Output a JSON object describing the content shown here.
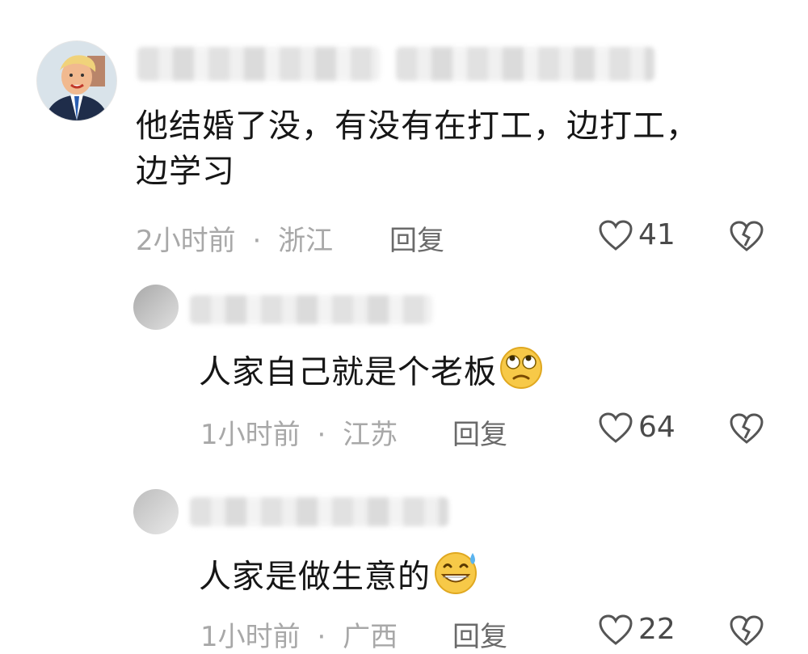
{
  "comments": [
    {
      "text": "他结婚了没，有没有在打工，边打工，边学习",
      "time": "2小时前",
      "location": "浙江",
      "reply_label": "回复",
      "likes": "41"
    },
    {
      "text": "人家自己就是个老板",
      "time": "1小时前",
      "location": "江苏",
      "reply_label": "回复",
      "likes": "64",
      "emoji": "rolling-eyes-emoji"
    },
    {
      "text": "人家是做生意的",
      "time": "1小时前",
      "location": "广西",
      "reply_label": "回复",
      "likes": "22",
      "emoji": "grinning-sweat-emoji"
    }
  ],
  "separator": "·"
}
